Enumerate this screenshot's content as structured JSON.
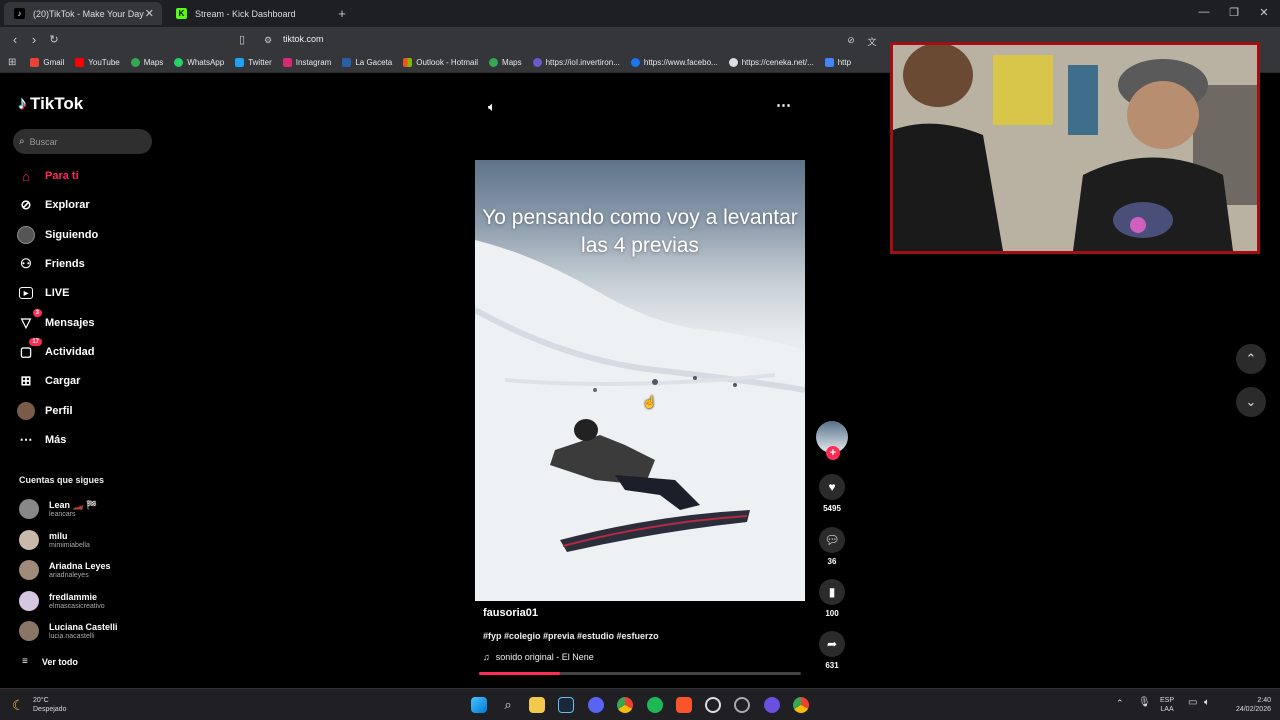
{
  "browser": {
    "tabs": [
      {
        "label": "(20)TikTok - Make Your Day",
        "active": true
      },
      {
        "label": "Stream - Kick Dashboard",
        "active": false
      }
    ],
    "url": "tiktok.com",
    "bookmarks": [
      "Gmail",
      "YouTube",
      "Maps",
      "WhatsApp",
      "Twitter",
      "Instagram",
      "La Gaceta",
      "Outlook - Hotmail",
      "Maps",
      "https://ioI.invertiron...",
      "https://www.facebo...",
      "https://ceneka.net/...",
      "http"
    ]
  },
  "tiktok": {
    "logo": "TikTok",
    "search_placeholder": "Buscar",
    "nav": [
      {
        "label": "Para ti",
        "icon": "home-icon",
        "active": true
      },
      {
        "label": "Explorar",
        "icon": "compass-icon"
      },
      {
        "label": "Siguiendo",
        "icon": "avatar-icon"
      },
      {
        "label": "Friends",
        "icon": "friends-icon"
      },
      {
        "label": "LIVE",
        "icon": "live-icon"
      },
      {
        "label": "Mensajes",
        "icon": "messages-icon",
        "badge": "3"
      },
      {
        "label": "Actividad",
        "icon": "activity-icon",
        "badge": "17"
      },
      {
        "label": "Cargar",
        "icon": "upload-icon"
      },
      {
        "label": "Perfil",
        "icon": "profile-icon"
      },
      {
        "label": "Más",
        "icon": "more-icon"
      }
    ],
    "following_title": "Cuentas que sigues",
    "following": [
      {
        "name": "Lean 🏎️ 🏁",
        "handle": "leancars"
      },
      {
        "name": "milu",
        "handle": "mimimiabella"
      },
      {
        "name": "Ariadna Leyes",
        "handle": "ariadnaleyes"
      },
      {
        "name": "fredlammie",
        "handle": "elmascasicreativo"
      },
      {
        "name": "Luciana Castelli",
        "handle": "lucia.nacastelli"
      }
    ],
    "see_all": "Ver todo",
    "video": {
      "caption": "Yo pensando como voy a levantar las 4 previas",
      "author": "fausoria01",
      "tags": "#fyp #colegio #previa #estudio #esfuerzo",
      "sound": "sonido original - El Nene",
      "progress": 0.25
    },
    "actions": {
      "likes": "5495",
      "comments": "36",
      "saves": "100",
      "shares": "631"
    }
  },
  "taskbar": {
    "weather_temp": "20°C",
    "weather_desc": "Despejado",
    "lang": "ESP",
    "lang2": "LAA",
    "time": "2:40",
    "date": "24/02/2026"
  },
  "colors": {
    "accent": "#fe2c55",
    "cam_border": "#a10f14"
  }
}
